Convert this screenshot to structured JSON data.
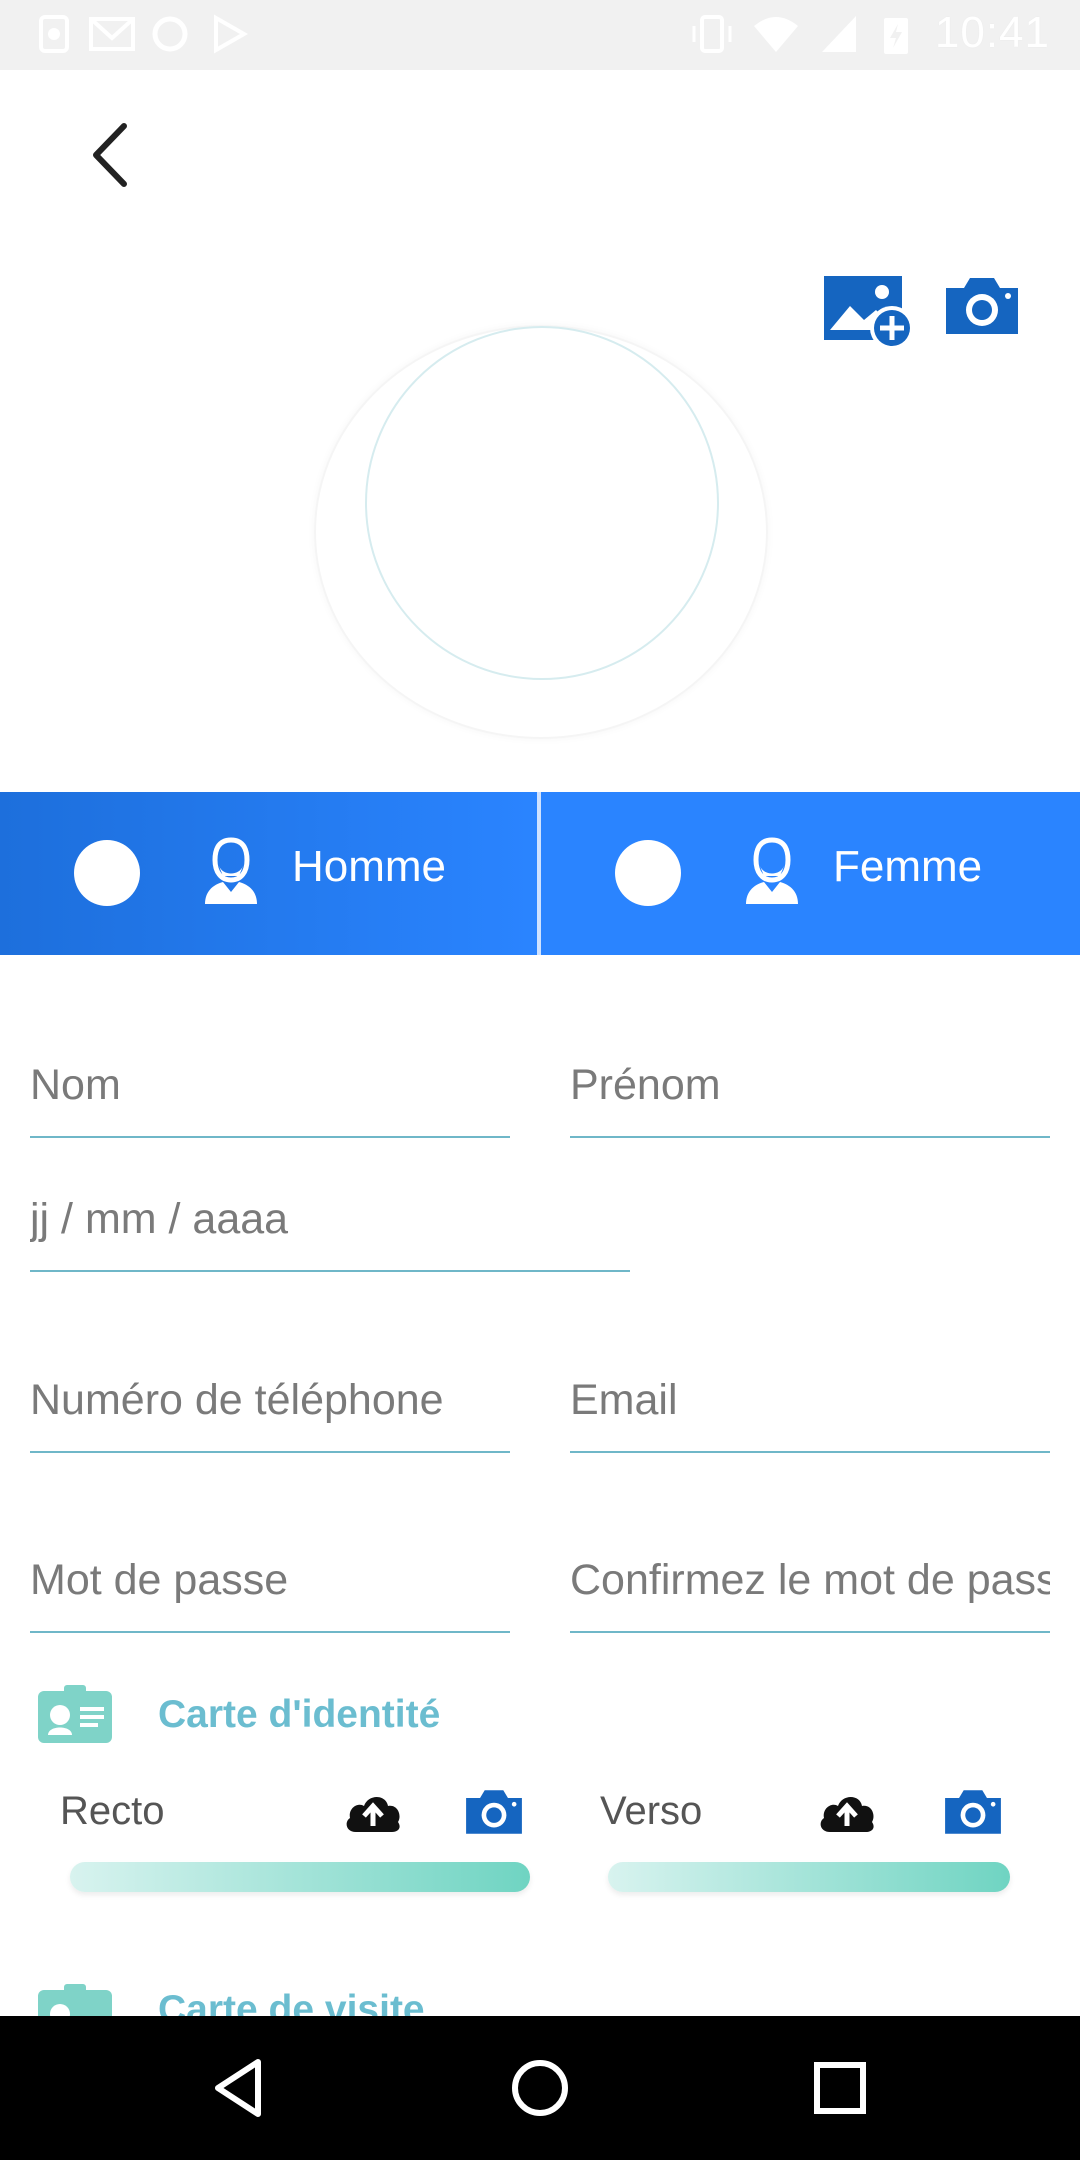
{
  "status_bar": {
    "time": "10:41",
    "icons": [
      "whatsapp-icon",
      "gmail-icon",
      "circle-app-icon",
      "play-store-icon",
      "vibrate-icon",
      "wifi-icon",
      "signal-icon",
      "battery-icon"
    ]
  },
  "header": {
    "back_icon": "back-arrow-icon"
  },
  "photo": {
    "gallery_icon": "add-image-icon",
    "camera_icon": "camera-icon"
  },
  "gender": {
    "options": [
      {
        "label": "Homme"
      },
      {
        "label": "Femme"
      }
    ]
  },
  "form": {
    "nom_placeholder": "Nom",
    "prenom_placeholder": "Prénom",
    "date_placeholder": "jj / mm / aaaa",
    "phone_placeholder": "Numéro de téléphone",
    "email_placeholder": "Email",
    "password_placeholder": "Mot de passe",
    "confirm_placeholder": "Confirmez le mot de passe"
  },
  "id_card": {
    "title": "Carte d'identité",
    "recto_label": "Recto",
    "verso_label": "Verso"
  },
  "business_card": {
    "title": "Carte de visite"
  },
  "colors": {
    "primary_blue": "#2a84ff",
    "dark_blue": "#1d6fdc",
    "accent_teal": "#6bbdd0",
    "icon_blue": "#1565c0",
    "progress_teal": "#6fd4c2"
  }
}
